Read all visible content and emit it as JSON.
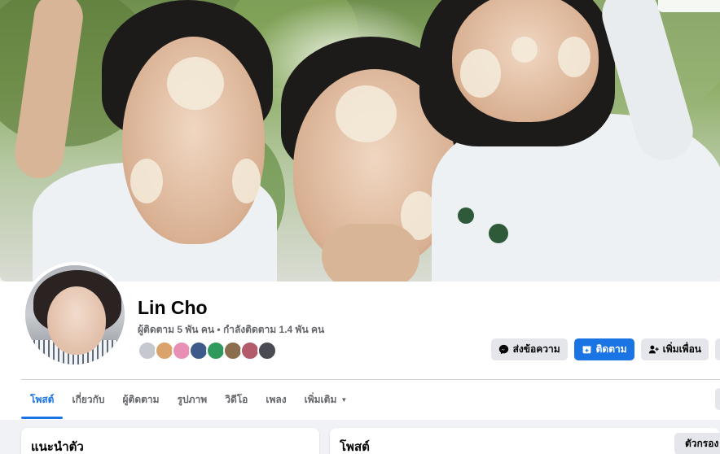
{
  "profile": {
    "name": "Lin Cho",
    "follow_stats": "ผู้ติดตาม 5 พัน คน • กำลังติดตาม 1.4 พัน คน"
  },
  "friends_preview": {
    "colors": [
      "#c5c9cf",
      "#d9a36b",
      "#e98fb5",
      "#3d5a8a",
      "#2f9a5c",
      "#8a6e4e",
      "#b25b6a",
      "#4a4a52"
    ]
  },
  "actions": {
    "message_label": "ส่งข้อความ",
    "follow_label": "ติดตาม",
    "add_friend_label": "เพิ่มเพื่อน"
  },
  "tabs": [
    {
      "label": "โพสต์",
      "active": true
    },
    {
      "label": "เกี่ยวกับ"
    },
    {
      "label": "ผู้ติดตาม"
    },
    {
      "label": "รูปภาพ"
    },
    {
      "label": "วิดีโอ"
    },
    {
      "label": "เพลง"
    },
    {
      "label": "เพิ่มเติม"
    }
  ],
  "intro": {
    "title": "แนะนำตัว"
  },
  "posts": {
    "title": "โพสต์",
    "filter_label": "ตัวกรอง"
  },
  "colors": {
    "accent": "#1b74e4",
    "secondary_button": "#e4e6eb",
    "muted_text": "#65676b"
  }
}
